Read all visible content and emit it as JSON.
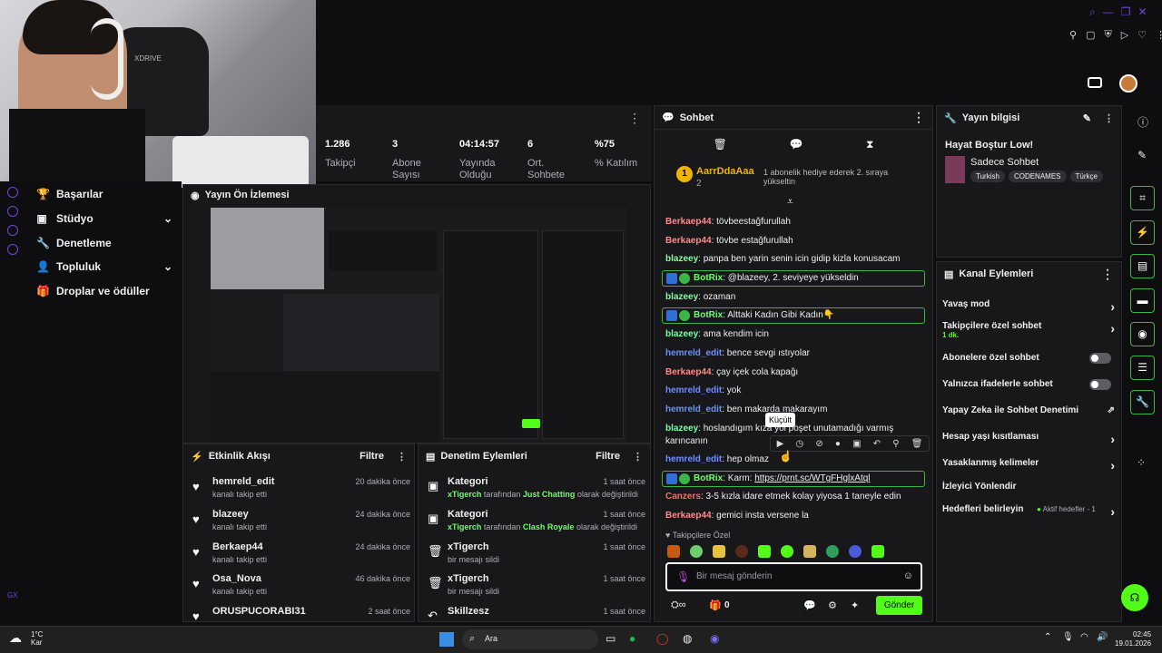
{
  "webcam": {
    "brand_text": "XDRIVE"
  },
  "sidebar": {
    "items": [
      {
        "label": "Başarılar",
        "icon": "trophy-icon"
      },
      {
        "label": "Stüdyo",
        "icon": "studio-icon"
      },
      {
        "label": "Denetleme",
        "icon": "wrench-icon"
      },
      {
        "label": "Topluluk",
        "icon": "community-icon"
      },
      {
        "label": "Droplar ve ödüller",
        "icon": "gift-icon"
      }
    ],
    "bottom_badge": "GX"
  },
  "stats": [
    {
      "value": "1.286",
      "label": "Takipçi"
    },
    {
      "value": "3",
      "label": "Abone Sayısı"
    },
    {
      "value": "04:14:57",
      "label": "Yayında Olduğu"
    },
    {
      "value": "6",
      "label": "Ort. Sohbete"
    },
    {
      "value": "%75",
      "label": "% Katılım"
    }
  ],
  "preview": {
    "title": "Yayın Ön İzlemesi"
  },
  "events": {
    "title": "Etkinlik Akışı",
    "filter": "Filtre",
    "items": [
      {
        "name": "hemreld_edit",
        "sub": "kanalı takip etti",
        "time": "20 dakika önce"
      },
      {
        "name": "blazeey",
        "sub": "kanalı takip etti",
        "time": "24 dakika önce"
      },
      {
        "name": "Berkaep44",
        "sub": "kanalı takip etti",
        "time": "24 dakika önce"
      },
      {
        "name": "Osa_Nova",
        "sub": "kanalı takip etti",
        "time": "46 dakika önce"
      },
      {
        "name": "ORUSPUCORABI31",
        "sub": "",
        "time": "2 saat önce"
      }
    ]
  },
  "modactions": {
    "title": "Denetim Eylemleri",
    "filter": "Filtre",
    "items": [
      {
        "name": "Kategori",
        "user": "xTigerch",
        "mid": " tarafından ",
        "cat": "Just Chatting",
        "end": " olarak değiştirildi",
        "time": "1 saat önce"
      },
      {
        "name": "Kategori",
        "user": "xTigerch",
        "mid": " tarafından ",
        "cat": "Clash Royale",
        "end": " olarak değiştirildi",
        "time": "1 saat önce"
      },
      {
        "name": "xTigerch",
        "sub": "bir mesajı sildi",
        "time": "1 saat önce"
      },
      {
        "name": "xTigerch",
        "sub": "bir mesajı sildi",
        "time": "1 saat önce"
      },
      {
        "name": "Skillzesz",
        "sub": "",
        "time": "1 saat önce"
      }
    ]
  },
  "chat": {
    "title": "Sohbet",
    "pinned": {
      "user": "AarrDdaAaa",
      "count": "2",
      "text": "1 abonelik hediye ederek 2. sıraya yükseltin",
      "rank": "1"
    },
    "messages": [
      {
        "user": "Berkaep44",
        "cls": "u-red",
        "text": ": tövbeestağfurullah"
      },
      {
        "user": "Berkaep44",
        "cls": "u-red",
        "text": ": tövbe estağfurullah"
      },
      {
        "user": "blazeey",
        "cls": "u-green",
        "text": ": panpa ben yarin senin icin gidip kizla konusacam"
      },
      {
        "user": "BotRix",
        "bot": true,
        "text": ": @blazeey, 2. seviyeye yükseldin"
      },
      {
        "user": "blazeey",
        "cls": "u-green",
        "text": ": ozaman"
      },
      {
        "user": "BotRix",
        "bot": true,
        "text": ": Alttaki Kadın Gibi Kadın👇"
      },
      {
        "user": "blazeey",
        "cls": "u-green",
        "text": ": ama kendim icin"
      },
      {
        "user": "hemreld_edit",
        "cls": "u-blue",
        "text": ": bence sevgi ıstıyolar"
      },
      {
        "user": "Berkaep44",
        "cls": "u-red",
        "text": ": çay içek cola kapağı"
      },
      {
        "user": "hemreld_edit",
        "cls": "u-blue",
        "text": ": yok"
      },
      {
        "user": "hemreld_edit",
        "cls": "u-blue",
        "text": ": ben makarda makarayım"
      },
      {
        "user": "blazeey",
        "cls": "u-green",
        "text": ": hoslandıgım kıza yol poşet unutamadığı varmış karıncanın"
      },
      {
        "user": "hemreld_edit",
        "cls": "u-blue",
        "text": ": hep olmaz"
      },
      {
        "user": "BotRix",
        "bot": true,
        "text": ": Karm: ",
        "link": "https://prnt.sc/WTgFHglxAtql"
      },
      {
        "user": "Canzers",
        "cls": "u-can",
        "text": ": 3-5 kızla idare etmek kolay yiyosa 1 taneyle edin"
      },
      {
        "user": "Berkaep44",
        "cls": "u-red",
        "text": ": gemici insta versene la"
      }
    ],
    "tooltip": "Küçült",
    "followers_only": "Takipçilere Özel",
    "input_placeholder": "Bir mesaj gönderin",
    "points": "0",
    "send": "Gönder"
  },
  "info": {
    "title": "Yayın bilgisi",
    "stream_title": "Hayat Boştur Low!",
    "category": "Sadece Sohbet",
    "tags": [
      "Turkish",
      "CODENAMES",
      "Türkçe"
    ]
  },
  "kanal": {
    "title": "Kanal Eylemleri",
    "items": [
      {
        "label": "Yavaş mod",
        "type": "chev"
      },
      {
        "label": "Takipçilere özel sohbet",
        "sub": "1 dk.",
        "type": "chev"
      },
      {
        "label": "Abonelere özel sohbet",
        "type": "toggle"
      },
      {
        "label": "Yalnızca ifadelerle sohbet",
        "type": "toggle"
      },
      {
        "label": "Yapay Zeka ile Sohbet Denetimi",
        "type": "ext"
      },
      {
        "label": "Hesap yaşı kısıtlaması",
        "type": "chev"
      },
      {
        "label": "Yasaklanmış kelimeler",
        "type": "chev"
      },
      {
        "label": "İzleyici Yönlendir",
        "type": "none"
      },
      {
        "label": "Hedefleri belirleyin",
        "sub2": "Aktif hedefler - 1",
        "type": "chev"
      }
    ]
  },
  "taskbar": {
    "weather_temp": "1°C",
    "weather_text": "Kar",
    "search": "Ara",
    "time": "02:45",
    "date": "19.01.2026"
  },
  "colors": {
    "accent": "#53fc18",
    "bg": "#0e0e10",
    "panel": "#18181b",
    "purple": "#6a49d6"
  }
}
